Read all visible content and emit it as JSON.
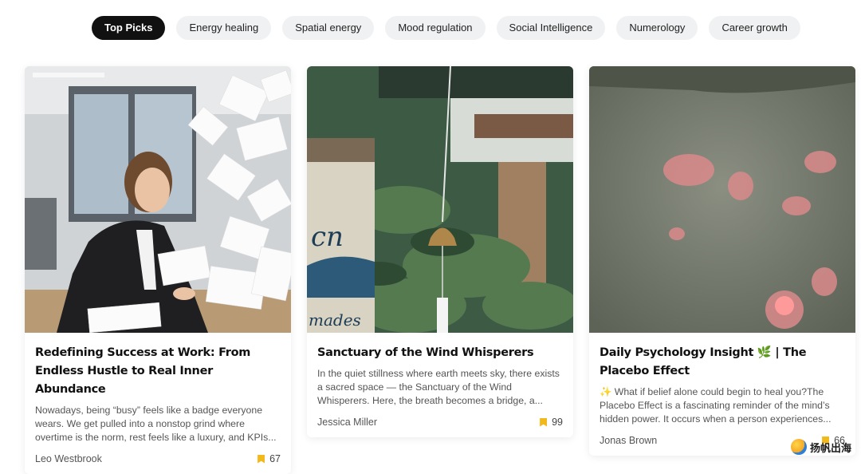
{
  "tabs": [
    {
      "label": "Top Picks",
      "active": true
    },
    {
      "label": "Energy healing",
      "active": false
    },
    {
      "label": "Spatial energy",
      "active": false
    },
    {
      "label": "Mood regulation",
      "active": false
    },
    {
      "label": "Social Intelligence",
      "active": false
    },
    {
      "label": "Numerology",
      "active": false
    },
    {
      "label": "Career growth",
      "active": false
    }
  ],
  "cards": [
    {
      "title": "Redefining Success at Work: From Endless Hustle to Real Inner Abundance",
      "excerpt": "Nowadays, being “busy” feels like a badge everyone wears. We get pulled into a nonstop grind where overtime is the norm, rest feels like a luxury, and KPIs...",
      "author": "Leo Westbrook",
      "likes": "67",
      "image_icon": "office-woman-papers-image"
    },
    {
      "title": "Sanctuary of the Wind Whisperers",
      "excerpt": "In the quiet stillness where earth meets sky, there exists a sacred space — the Sanctuary of the Wind Whisperers. Here, the breath becomes a bridge, a...",
      "author": "Jessica Miller",
      "likes": "99",
      "image_icon": "wind-chime-image"
    },
    {
      "title": "Daily Psychology Insight 🌿 | The Placebo Effect",
      "excerpt": "✨ What if belief alone could begin to heal you?The Placebo Effect is a fascinating reminder of the mind’s hidden power. It occurs when a person experiences...",
      "author": "Jonas Brown",
      "likes": "66",
      "image_icon": "blurred-flowers-image"
    }
  ],
  "watermark": {
    "text": "扬帆出海"
  },
  "colors": {
    "accent_bookmark": "#f2b91c",
    "tab_active_bg": "#111111",
    "tab_bg": "#f0f1f3"
  }
}
